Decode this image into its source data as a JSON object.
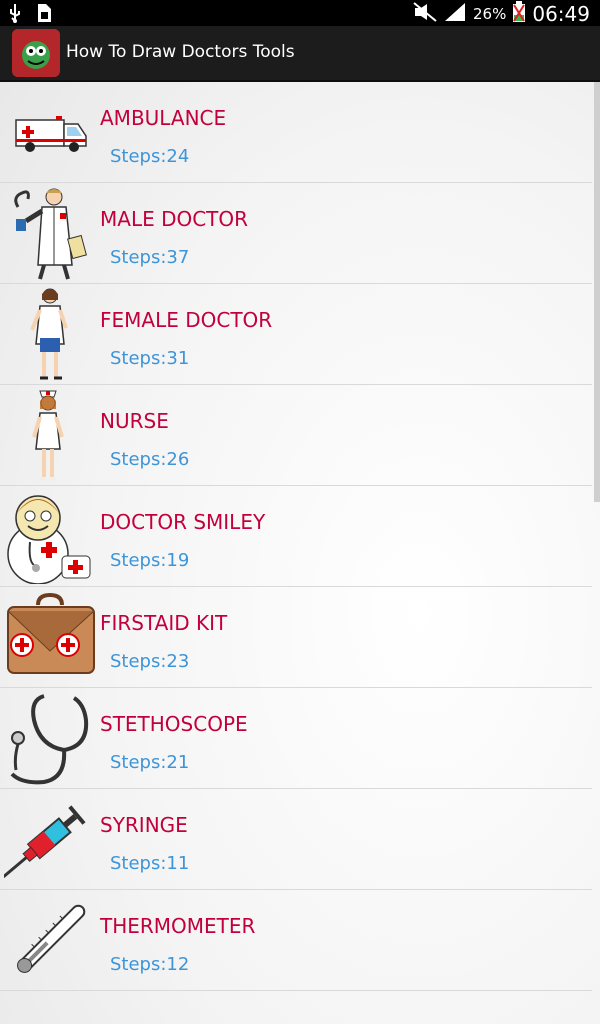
{
  "status_bar": {
    "battery_percent": "26%",
    "time": "06:49",
    "icons": [
      "usb-icon",
      "sim-icon",
      "mute-icon",
      "signal-icon",
      "battery-icon"
    ]
  },
  "app_bar": {
    "title": "How To Draw Doctors Tools"
  },
  "items": [
    {
      "title": "AMBULANCE",
      "steps": "Steps:24",
      "icon": "ambulance-icon"
    },
    {
      "title": "MALE DOCTOR",
      "steps": "Steps:37",
      "icon": "male-doctor-icon"
    },
    {
      "title": "FEMALE DOCTOR",
      "steps": "Steps:31",
      "icon": "female-doctor-icon"
    },
    {
      "title": "NURSE",
      "steps": "Steps:26",
      "icon": "nurse-icon"
    },
    {
      "title": "DOCTOR SMILEY",
      "steps": "Steps:19",
      "icon": "doctor-smiley-icon"
    },
    {
      "title": "FIRSTAID KIT",
      "steps": "Steps:23",
      "icon": "firstaid-kit-icon"
    },
    {
      "title": "STETHOSCOPE",
      "steps": "Steps:21",
      "icon": "stethoscope-icon"
    },
    {
      "title": "SYRINGE",
      "steps": "Steps:11",
      "icon": "syringe-icon"
    },
    {
      "title": "THERMOMETER",
      "steps": "Steps:12",
      "icon": "thermometer-icon"
    }
  ],
  "colors": {
    "title": "#c3003e",
    "steps": "#3d95d8",
    "action_bar": "#1c1c1c"
  }
}
